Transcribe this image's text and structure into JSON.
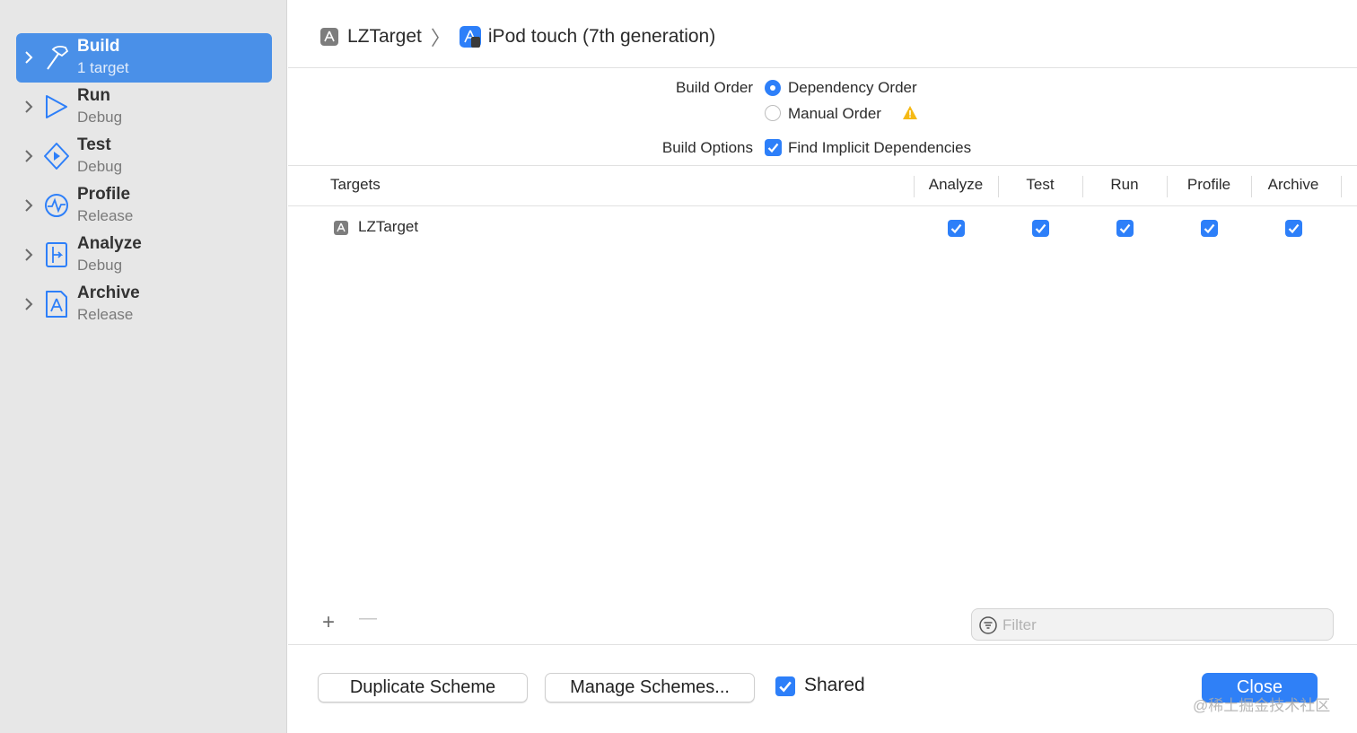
{
  "sidebar": {
    "items": [
      {
        "title": "Build",
        "subtitle": "1 target",
        "icon": "hammer-icon",
        "active": true
      },
      {
        "title": "Run",
        "subtitle": "Debug",
        "icon": "play-icon"
      },
      {
        "title": "Test",
        "subtitle": "Debug",
        "icon": "test-diamond-icon"
      },
      {
        "title": "Profile",
        "subtitle": "Release",
        "icon": "waveform-icon"
      },
      {
        "title": "Analyze",
        "subtitle": "Debug",
        "icon": "analyze-icon"
      },
      {
        "title": "Archive",
        "subtitle": "Release",
        "icon": "archive-icon"
      }
    ]
  },
  "breadcrumb": {
    "target": "LZTarget",
    "device": "iPod touch (7th generation)"
  },
  "build_order": {
    "label": "Build Order",
    "options": [
      "Dependency Order",
      "Manual Order"
    ],
    "selected": "Dependency Order"
  },
  "build_options": {
    "label": "Build Options",
    "checkbox_label": "Find Implicit Dependencies",
    "checked": true
  },
  "table": {
    "columns": [
      "Targets",
      "Analyze",
      "Test",
      "Run",
      "Profile",
      "Archive"
    ],
    "rows": [
      {
        "name": "LZTarget",
        "analyze": true,
        "test": true,
        "run": true,
        "profile": true,
        "archive": true
      }
    ]
  },
  "toolbar": {
    "add": "+",
    "remove": "—"
  },
  "filter": {
    "placeholder": "Filter"
  },
  "footer": {
    "duplicate": "Duplicate Scheme",
    "manage": "Manage Schemes...",
    "shared_label": "Shared",
    "shared": true,
    "close": "Close"
  },
  "watermark": "@稀土掘金技术社区",
  "colors": {
    "accent": "#2d7ff9",
    "sidebar_selected": "#4a90e8",
    "warning": "#f5b915"
  }
}
